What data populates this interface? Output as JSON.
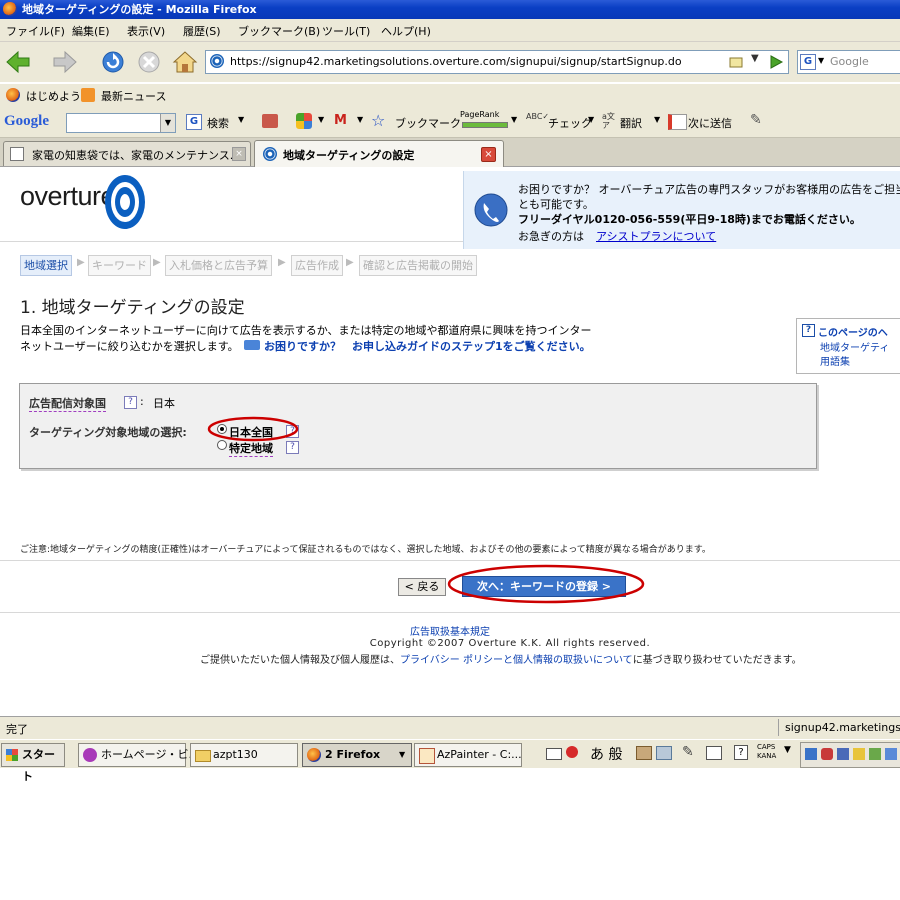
{
  "window": {
    "title": "地域ターゲティングの設定 - Mozilla Firefox"
  },
  "menu": [
    "ファイル(F)",
    "編集(E)",
    "表示(V)",
    "履歴(S)",
    "ブックマーク(B)",
    "ツール(T)",
    "ヘルプ(H)"
  ],
  "nav": {
    "url": "https://signup42.marketingsolutions.overture.com/signupui/signup/startSignup.do",
    "search_placeholder": "Google"
  },
  "bookmarks": [
    "はじめよう",
    "最新ニュース"
  ],
  "gtoolbar": {
    "logo": "Google",
    "search_btn": "検索",
    "bookmark": "ブックマーク",
    "pagerank": "PageRank",
    "check": "チェック",
    "translate": "翻訳",
    "send": "次に送信"
  },
  "tabs": [
    {
      "label": "家電の知恵袋では、家電のメンテナンス..."
    },
    {
      "label": "地域ターゲティングの設定"
    }
  ],
  "page": {
    "logo": "overture",
    "help_box": {
      "line1": "お困りですか？ オーバーチュア広告の専門スタッフがお客様用の広告をご担当",
      "line2": "とも可能です。",
      "line3": "フリーダイヤル0120-056-559(平日9-18時)までお電話ください。",
      "line4_prefix": "お急ぎの方は",
      "line4_link": "アシストプランについて"
    },
    "steps": [
      "地域選択",
      "キーワード",
      "入札価格と広告予算",
      "広告作成",
      "確認と広告掲載の開始"
    ],
    "heading": "1. 地域ターゲティングの設定",
    "intro1": "日本全国のインターネットユーザーに向けて広告を表示するか、または特定の地域や都道府県に興味を持つインター",
    "intro2": "ネットユーザーに絞り込むかを選択します。",
    "intro_link": "お困りですか？　お申し込みガイドのステップ1をご覧ください。",
    "side_box": {
      "title": "このページのヘ",
      "link1": "地域ターゲティ",
      "link2": "用語集"
    },
    "form": {
      "country_label": "広告配信対象国",
      "country_value": "日本",
      "region_label": "ターゲティング対象地域の選択:",
      "opt1": "日本全国",
      "opt2": "特定地域"
    },
    "notice": "ご注意:地域ターゲティングの精度(正確性)はオーバーチュアによって保証されるものではなく、選択した地域、およびその他の要素によって精度が異なる場合があります。",
    "back_btn": "< 戻る",
    "next_btn": "次へ：キーワードの登録 >",
    "footer": {
      "link1": "広告取扱基本規定",
      "copyright": "Copyright ©2007 Overture K.K. All rights reserved.",
      "privacy_prefix": "ご提供いただいた個人情報及び個人履歴は、",
      "privacy_link": "プライバシー ポリシーと個人情報の取扱いについて",
      "privacy_suffix": "に基づき取り扱わせていただきます。"
    }
  },
  "status": {
    "left": "完了",
    "right": "signup42.marketingsolu"
  },
  "taskbar": {
    "start": "スタート",
    "items": [
      "ホームページ・ビ...",
      "azpt130",
      "2 Firefox",
      "AzPainter - C:..."
    ],
    "ime": "あ 般",
    "caps": "CAPS",
    "kana": "KANA"
  },
  "colors": {
    "accent": "#3a73c8",
    "titlebar": "#0a3fc4",
    "annotation": "#cc0000"
  }
}
